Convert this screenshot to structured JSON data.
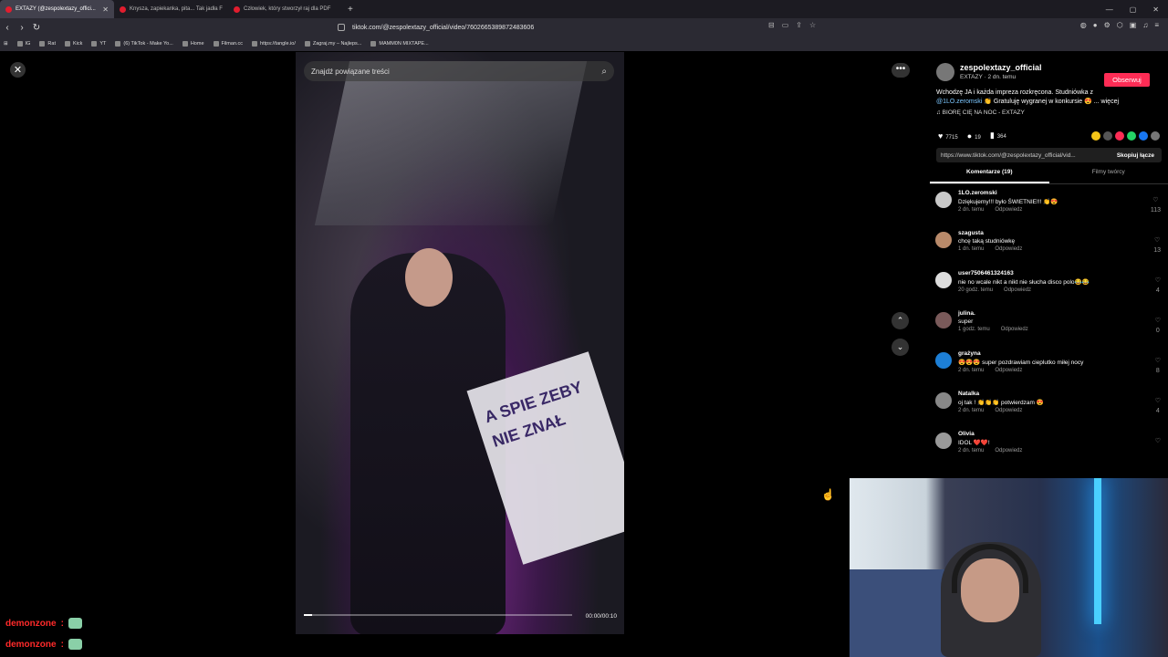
{
  "browser": {
    "tabs": [
      {
        "label": "EXTAZY (@zespolextazy_offici...",
        "active": true
      },
      {
        "label": "Knysza, zapiekanka, pita... Tak jadła F",
        "active": false
      },
      {
        "label": "Człowiek, który stworzył raj dla PDF",
        "active": false
      }
    ],
    "url": "tiktok.com/@zespolextazy_official/video/7602665389872483606",
    "bookmarks": [
      "IG",
      "Rat",
      "Kick",
      "YT",
      "(6) TikTok - Make Yo...",
      "Home",
      "Filman.cc",
      "https://tangle.io/",
      "Zagraj.my – Najleps...",
      "MAMM0N MIXTAPE..."
    ]
  },
  "video": {
    "search_placeholder": "Znajdź powiązane treści",
    "time": "00:00/00:10",
    "progress": 0.03,
    "sign_text": "A SPIE ZEBY NIE ZNAŁ"
  },
  "sidebar": {
    "author": "zespolextazy_official",
    "author_sub": "EXTAZY · 2 dn. temu",
    "follow_label": "Obserwuj",
    "description": "Wchodzę JA i każda impreza rozkręcona. Studniówka z",
    "mention": "@1LO.zeromski",
    "description_rest": "👏 Gratuluję wygranej w konkursie 😍 ... więcej",
    "music": "♫ BIORĘ CIĘ NA NOC - EXTAZY",
    "likes": "7715",
    "comments_count": "19",
    "saves": "364",
    "link": "https://www.tiktok.com/@zespolextazy_official/vid...",
    "copy_label": "Skopiuj łącze",
    "tab_comments": "Komentarze (19)",
    "tab_creator": "Filmy twórcy",
    "reply_label": "Odpowiedz",
    "comments": [
      {
        "user": "1LO.zeromski",
        "text": "Dziękujemy!!! było ŚWIETNIE!!! 👏😍",
        "time": "2 dn. temu",
        "likes": "113",
        "color": "#c9c9c9"
      },
      {
        "user": "szagusta",
        "text": "chcę taką studniówkę",
        "time": "1 dn. temu",
        "likes": "13",
        "color": "#b98a6a"
      },
      {
        "user": "user7506461324163",
        "text": "nie no wcale nikt a nikt nie słucha disco polo😂😂",
        "time": "20 godz. temu",
        "likes": "4",
        "color": "#dddddd"
      },
      {
        "user": "julina.",
        "text": "super",
        "time": "1 godz. temu",
        "likes": "0",
        "color": "#7a5a5a"
      },
      {
        "user": "grażyna",
        "text": "😍😍😍 super pozdrawiam cieplutko miłej nocy",
        "time": "2 dn. temu",
        "likes": "8",
        "color": "#1d7fd6"
      },
      {
        "user": "Natalka",
        "text": "oj tak ! 👏👏👏 potwierdzam 😍",
        "time": "2 dn. temu",
        "likes": "4",
        "color": "#888888"
      },
      {
        "user": "Olivia",
        "text": "IDOL ❤️❤️!",
        "time": "2 dn. temu",
        "likes": "",
        "color": "#999999"
      }
    ]
  },
  "chat": [
    {
      "user": "demonzone",
      "sep": ":"
    },
    {
      "user": "demonzone",
      "sep": ":"
    }
  ],
  "colors": {
    "accent": "#fe2c55",
    "chat_user": "#ff2a2a"
  }
}
